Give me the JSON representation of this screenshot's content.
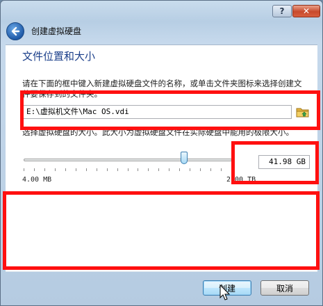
{
  "window": {
    "help_label": "?",
    "close_label": "✕",
    "header_title": "创建虚拟硬盘"
  },
  "page": {
    "section_title": "文件位置和大小",
    "location_description": "请在下面的框中键入新建虚拟硬盘文件的名称，或单击文件夹图标来选择创建文件要保存到的文件夹。",
    "path_value": "E:\\虚拟机文件\\Mac OS.vdi",
    "size_description": "选择虚拟硬盘的大小。此大小为虚拟硬盘文件在实际硬盘中能用的极限大小。",
    "size_value": "41.98 GB",
    "min_label": "4.00 MB",
    "max_label": "2.00 TB",
    "slider_position": 0.77
  },
  "footer": {
    "create_label": "创建",
    "cancel_label": "取消"
  },
  "colors": {
    "annotation_red": "#ff1010",
    "title_blue": "#1b3f8a"
  },
  "icons": {
    "back": "back-arrow-icon",
    "folder": "folder-icon",
    "cursor": "mouse-pointer-icon"
  }
}
